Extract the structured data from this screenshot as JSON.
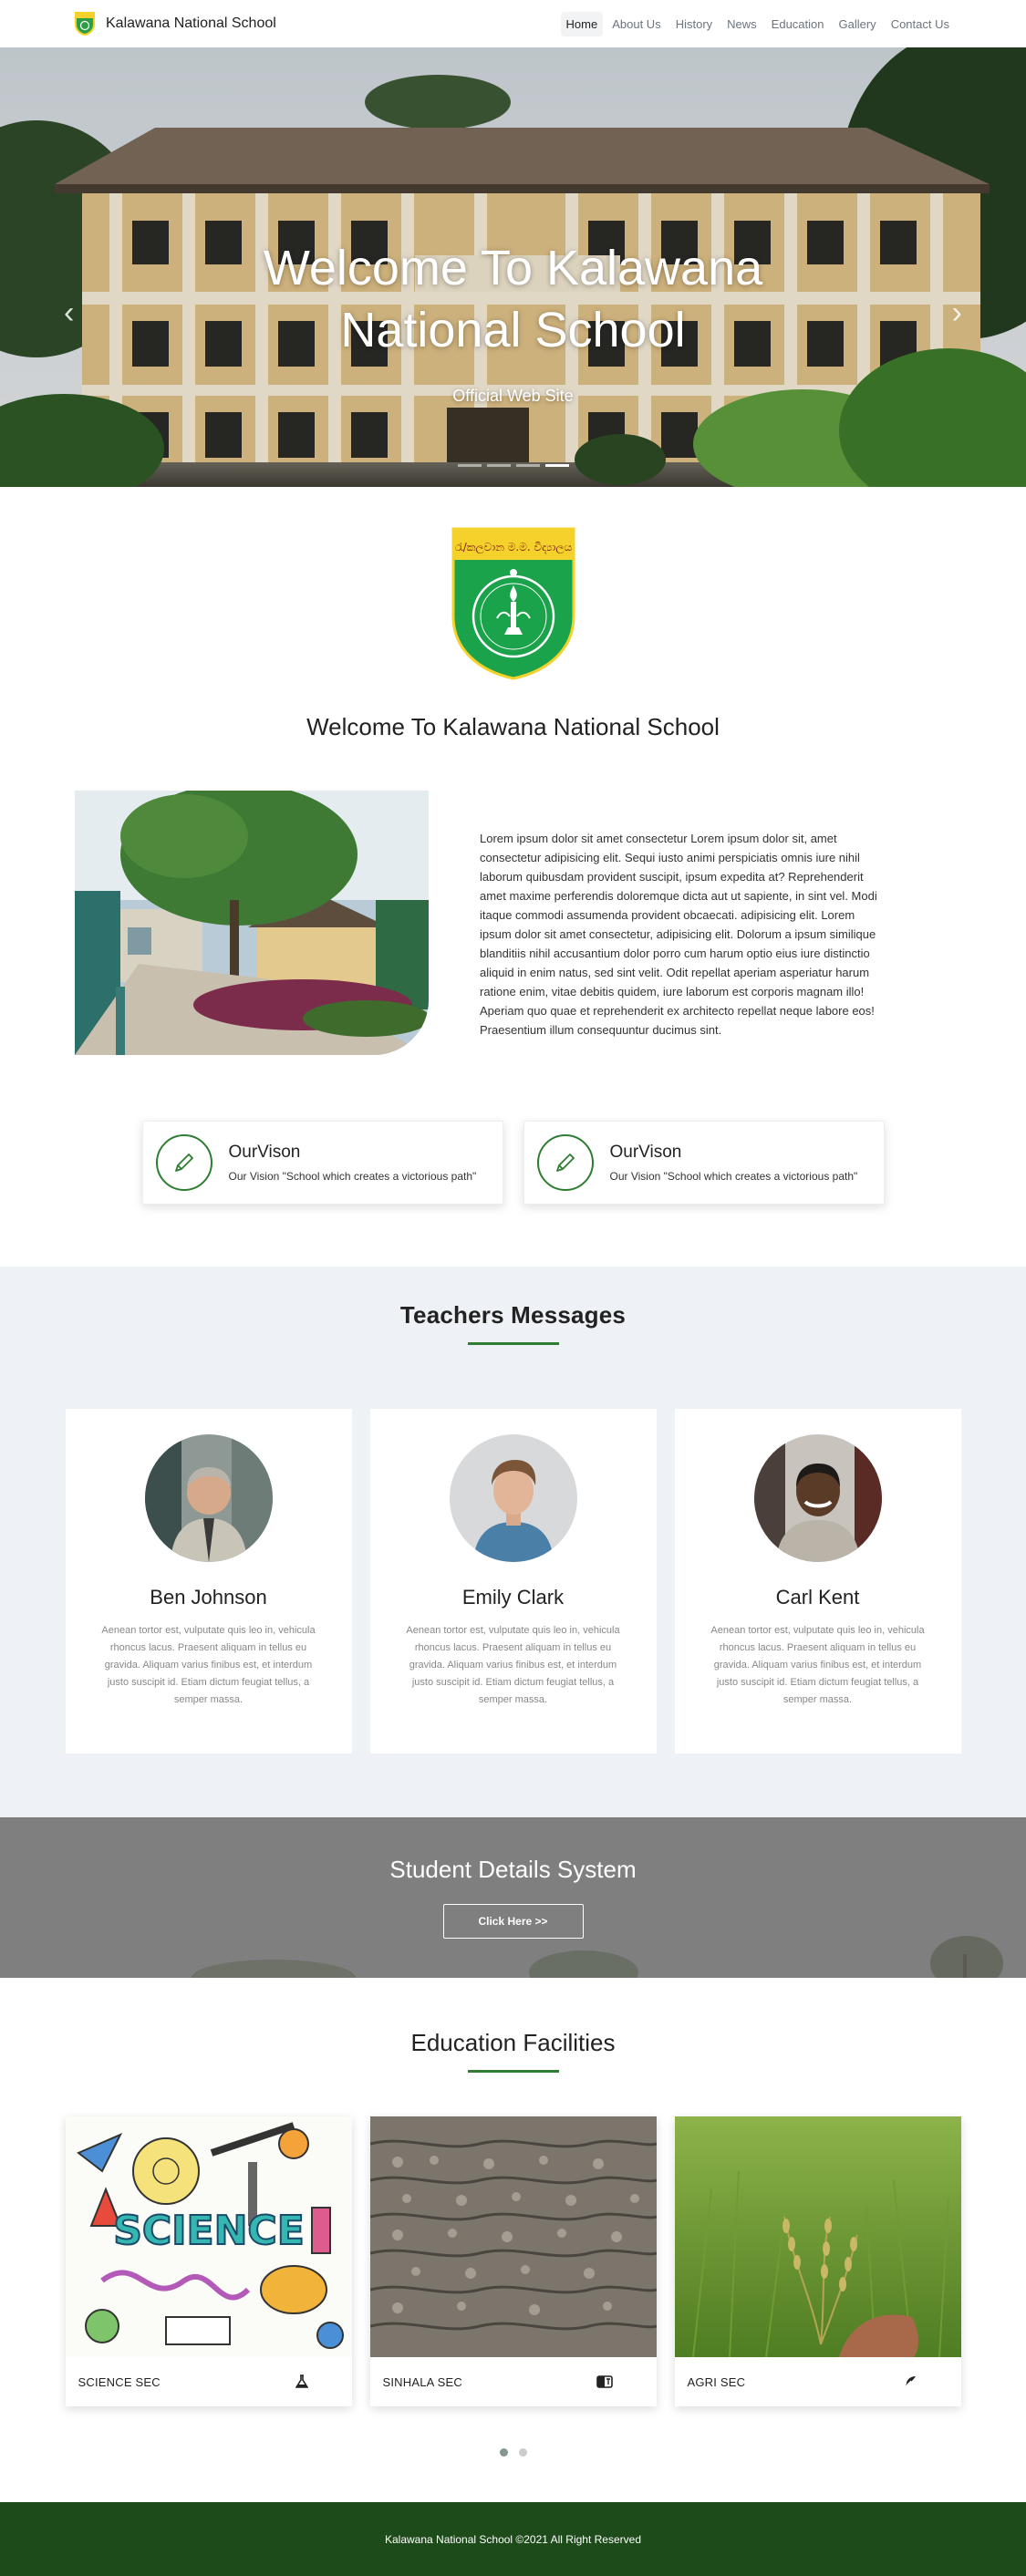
{
  "nav": {
    "brand": "Kalawana National School",
    "links": [
      "Home",
      "About Us",
      "History",
      "News",
      "Education",
      "Gallery",
      "Contact Us"
    ]
  },
  "hero": {
    "title": "Welcome To Kalawana National School",
    "subtitle": "Official Web Site",
    "slides": 4,
    "active_slide": 4
  },
  "about": {
    "heading": "Welcome To Kalawana National School",
    "crest_text": "රැ/කලවාන ම.ම. විද්‍යාලය",
    "paragraph": "Lorem ipsum dolor sit amet consectetur Lorem ipsum dolor sit, amet consectetur adipisicing elit. Sequi iusto animi perspiciatis omnis iure nihil laborum quibusdam provident suscipit, ipsum expedita at? Reprehenderit amet maxime perferendis doloremque dicta aut ut sapiente, in sint vel. Modi itaque commodi assumenda provident obcaecati. adipisicing elit. Lorem ipsum dolor sit amet consectetur, adipisicing elit. Dolorum a ipsum similique blanditiis nihil accusantium dolor porro cum harum optio eius iure distinctio aliquid in enim natus, sed sint velit. Odit repellat aperiam asperiatur harum ratione enim, vitae debitis quidem, iure laborum est corporis magnam illo! Aperiam quo quae et reprehenderit ex architecto repellat neque labore eos! Praesentium illum consequuntur ducimus sint."
  },
  "vision": [
    {
      "title": "OurVison",
      "desc": "Our Vision \"School which creates a victorious path\""
    },
    {
      "title": "OurVison",
      "desc": "Our Vision \"School which creates a victorious path\""
    }
  ],
  "teachers": {
    "heading": "Teachers Messages",
    "items": [
      {
        "name": "Ben Johnson",
        "text": "Aenean tortor est, vulputate quis leo in, vehicula rhoncus lacus. Praesent aliquam in tellus eu gravida. Aliquam varius finibus est, et interdum justo suscipit id. Etiam dictum feugiat tellus, a semper massa."
      },
      {
        "name": "Emily Clark",
        "text": "Aenean tortor est, vulputate quis leo in, vehicula rhoncus lacus. Praesent aliquam in tellus eu gravida. Aliquam varius finibus est, et interdum justo suscipit id. Etiam dictum feugiat tellus, a semper massa."
      },
      {
        "name": "Carl Kent",
        "text": "Aenean tortor est, vulputate quis leo in, vehicula rhoncus lacus. Praesent aliquam in tellus eu gravida. Aliquam varius finibus est, et interdum justo suscipit id. Etiam dictum feugiat tellus, a semper massa."
      }
    ]
  },
  "student": {
    "heading": "Student Details System",
    "button": "Click Here >>"
  },
  "facilities": {
    "heading": "Education Facilities",
    "items": [
      {
        "label": "SCIENCE SEC",
        "icon": "flask-icon"
      },
      {
        "label": "SINHALA SEC",
        "icon": "language-icon"
      },
      {
        "label": "AGRI SEC",
        "icon": "seedling-icon"
      }
    ],
    "pages": 2,
    "active_page": 1
  },
  "footer": {
    "text": "Kalawana National School ©2021 All Right Reserved"
  },
  "colors": {
    "accent": "#2e7d32",
    "footer": "#1e4b1a",
    "teachers_bg": "#eef2f6",
    "student_bg": "#7d7d7d"
  }
}
